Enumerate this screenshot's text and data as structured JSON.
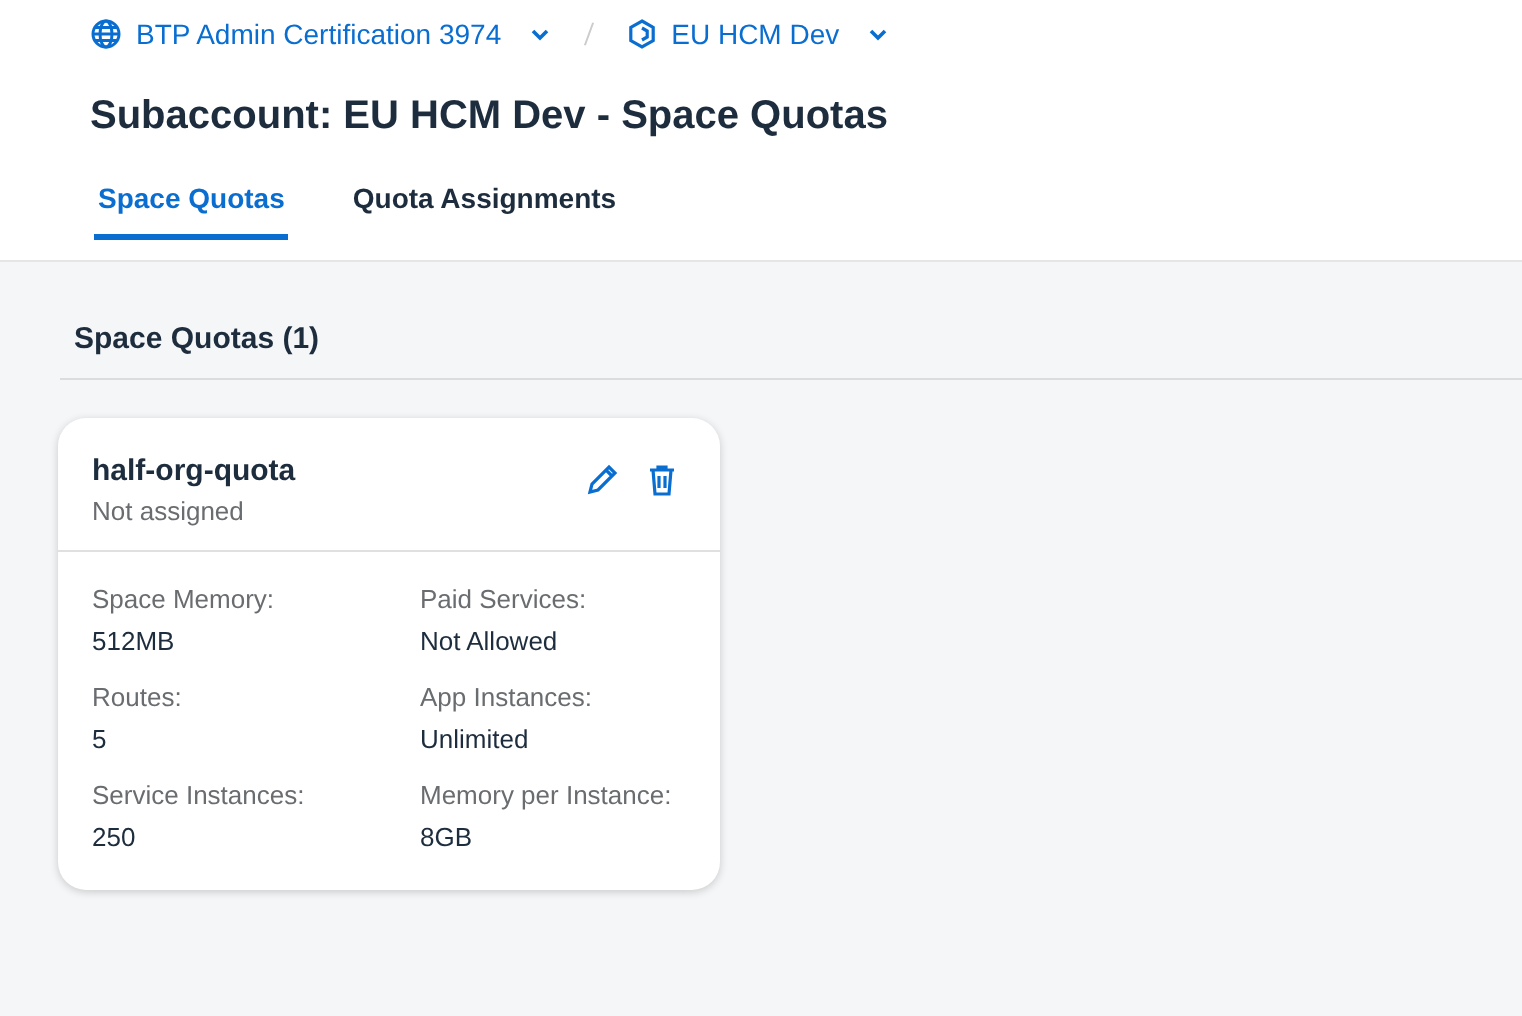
{
  "breadcrumb": [
    {
      "kind": "global-account",
      "label": "BTP Admin Certification 3974"
    },
    {
      "kind": "subaccount",
      "label": "EU HCM Dev"
    }
  ],
  "title": "Subaccount: EU HCM Dev - Space Quotas",
  "tabs": [
    {
      "label": "Space Quotas",
      "selected": true
    },
    {
      "label": "Quota Assignments",
      "selected": false
    }
  ],
  "section": {
    "title": "Space Quotas (1)"
  },
  "cards": [
    {
      "name": "half-org-quota",
      "status": "Not assigned",
      "fields": [
        {
          "label": "Space Memory:",
          "value": "512MB"
        },
        {
          "label": "Paid Services:",
          "value": "Not Allowed"
        },
        {
          "label": "Routes:",
          "value": "5"
        },
        {
          "label": "App Instances:",
          "value": "Unlimited"
        },
        {
          "label": "Service Instances:",
          "value": "250"
        },
        {
          "label": "Memory per Instance:",
          "value": "8GB"
        }
      ]
    }
  ]
}
